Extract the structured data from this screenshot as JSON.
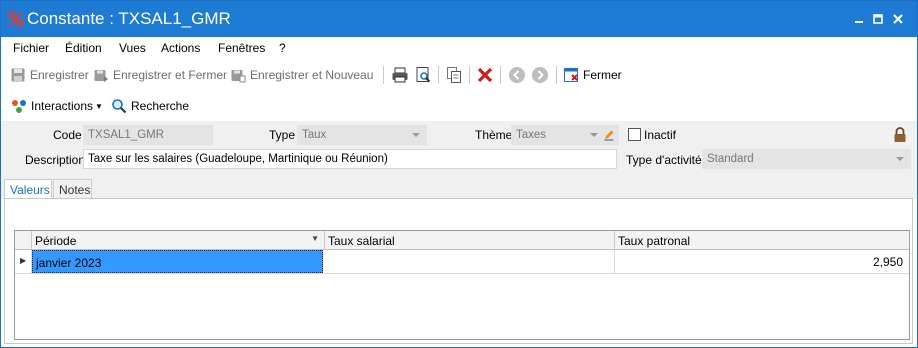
{
  "window": {
    "title": "Constante : TXSAL1_GMR",
    "accent": "#1e7bd3"
  },
  "menu": [
    "Fichier",
    "Édition",
    "Vues",
    "Actions",
    "Fenêtres",
    "?"
  ],
  "toolbar": {
    "save": "Enregistrer",
    "save_close": "Enregistrer et Fermer",
    "save_new": "Enregistrer et Nouveau",
    "close": "Fermer"
  },
  "toolbar2": {
    "interactions": "Interactions",
    "search": "Recherche"
  },
  "form": {
    "code_label": "Code",
    "code_value": "TXSAL1_GMR",
    "type_label": "Type",
    "type_value": "Taux",
    "theme_label": "Thème",
    "theme_value": "Taxes",
    "inactive_label": "Inactif",
    "inactive_checked": false,
    "description_label": "Description",
    "description_value": "Taxe sur les salaires (Guadeloupe, Martinique ou Réunion)",
    "activity_type_label": "Type d'activité",
    "activity_type_value": "Standard"
  },
  "tabs": [
    {
      "label": "Valeurs",
      "active": true
    },
    {
      "label": "Notes",
      "active": false
    }
  ],
  "grid": {
    "columns": [
      "Période",
      "Taux salarial",
      "Taux patronal"
    ],
    "rows": [
      {
        "periode": "janvier 2023",
        "taux_salarial": "",
        "taux_patronal": "2,950"
      }
    ]
  }
}
